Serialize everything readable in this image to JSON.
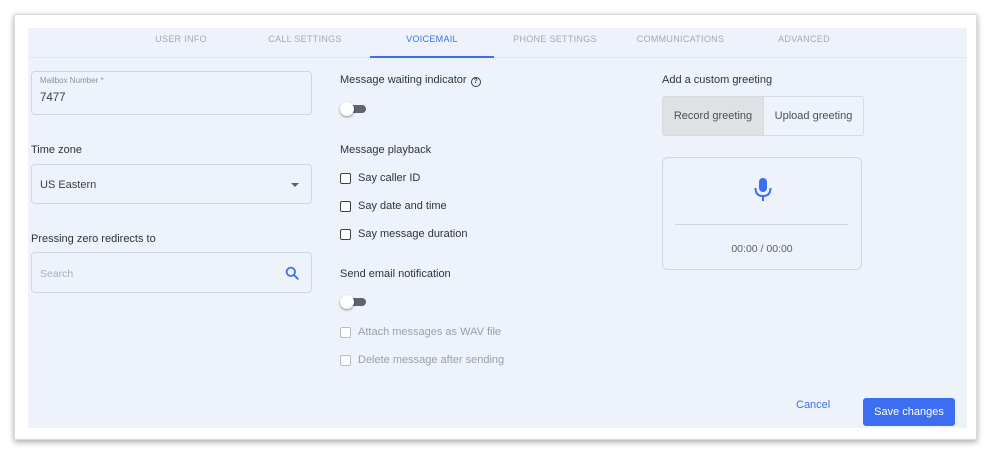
{
  "tabs": [
    {
      "label": "USER INFO"
    },
    {
      "label": "CALL SETTINGS"
    },
    {
      "label": "VOICEMAIL",
      "active": true
    },
    {
      "label": "PHONE SETTINGS"
    },
    {
      "label": "COMMUNICATIONS"
    },
    {
      "label": "ADVANCED"
    }
  ],
  "left": {
    "mailbox": {
      "label": "Mailbox Number *",
      "value": "7477"
    },
    "timezone": {
      "label": "Time zone",
      "value": "US Eastern"
    },
    "zero_redirect": {
      "label": "Pressing zero redirects to",
      "placeholder": "Search"
    }
  },
  "middle": {
    "mwi_label": "Message waiting indicator",
    "mwi_help_glyph": "?",
    "mwi_enabled": false,
    "playback_label": "Message playback",
    "playback_options": [
      {
        "label": "Say caller ID",
        "checked": false
      },
      {
        "label": "Say date and time",
        "checked": false
      },
      {
        "label": "Say message duration",
        "checked": false
      }
    ],
    "email_label": "Send email notification",
    "email_enabled": false,
    "email_options": [
      {
        "label": "Attach messages as WAV file",
        "checked": false,
        "disabled": true
      },
      {
        "label": "Delete message after sending",
        "checked": false,
        "disabled": true
      }
    ]
  },
  "right": {
    "greeting_label": "Add a custom greeting",
    "record_tab": "Record greeting",
    "upload_tab": "Upload greeting",
    "active_tab": "Record greeting",
    "time_readout": "00:00 / 00:00"
  },
  "actions": {
    "cancel": "Cancel",
    "save": "Save changes"
  },
  "colors": {
    "accent": "#3d6ef0",
    "panel_bg": "#eef3fb"
  },
  "icons": {
    "help": "help-circle-icon",
    "search": "search-icon",
    "dropdown": "chevron-down-icon",
    "mic": "microphone-icon"
  }
}
